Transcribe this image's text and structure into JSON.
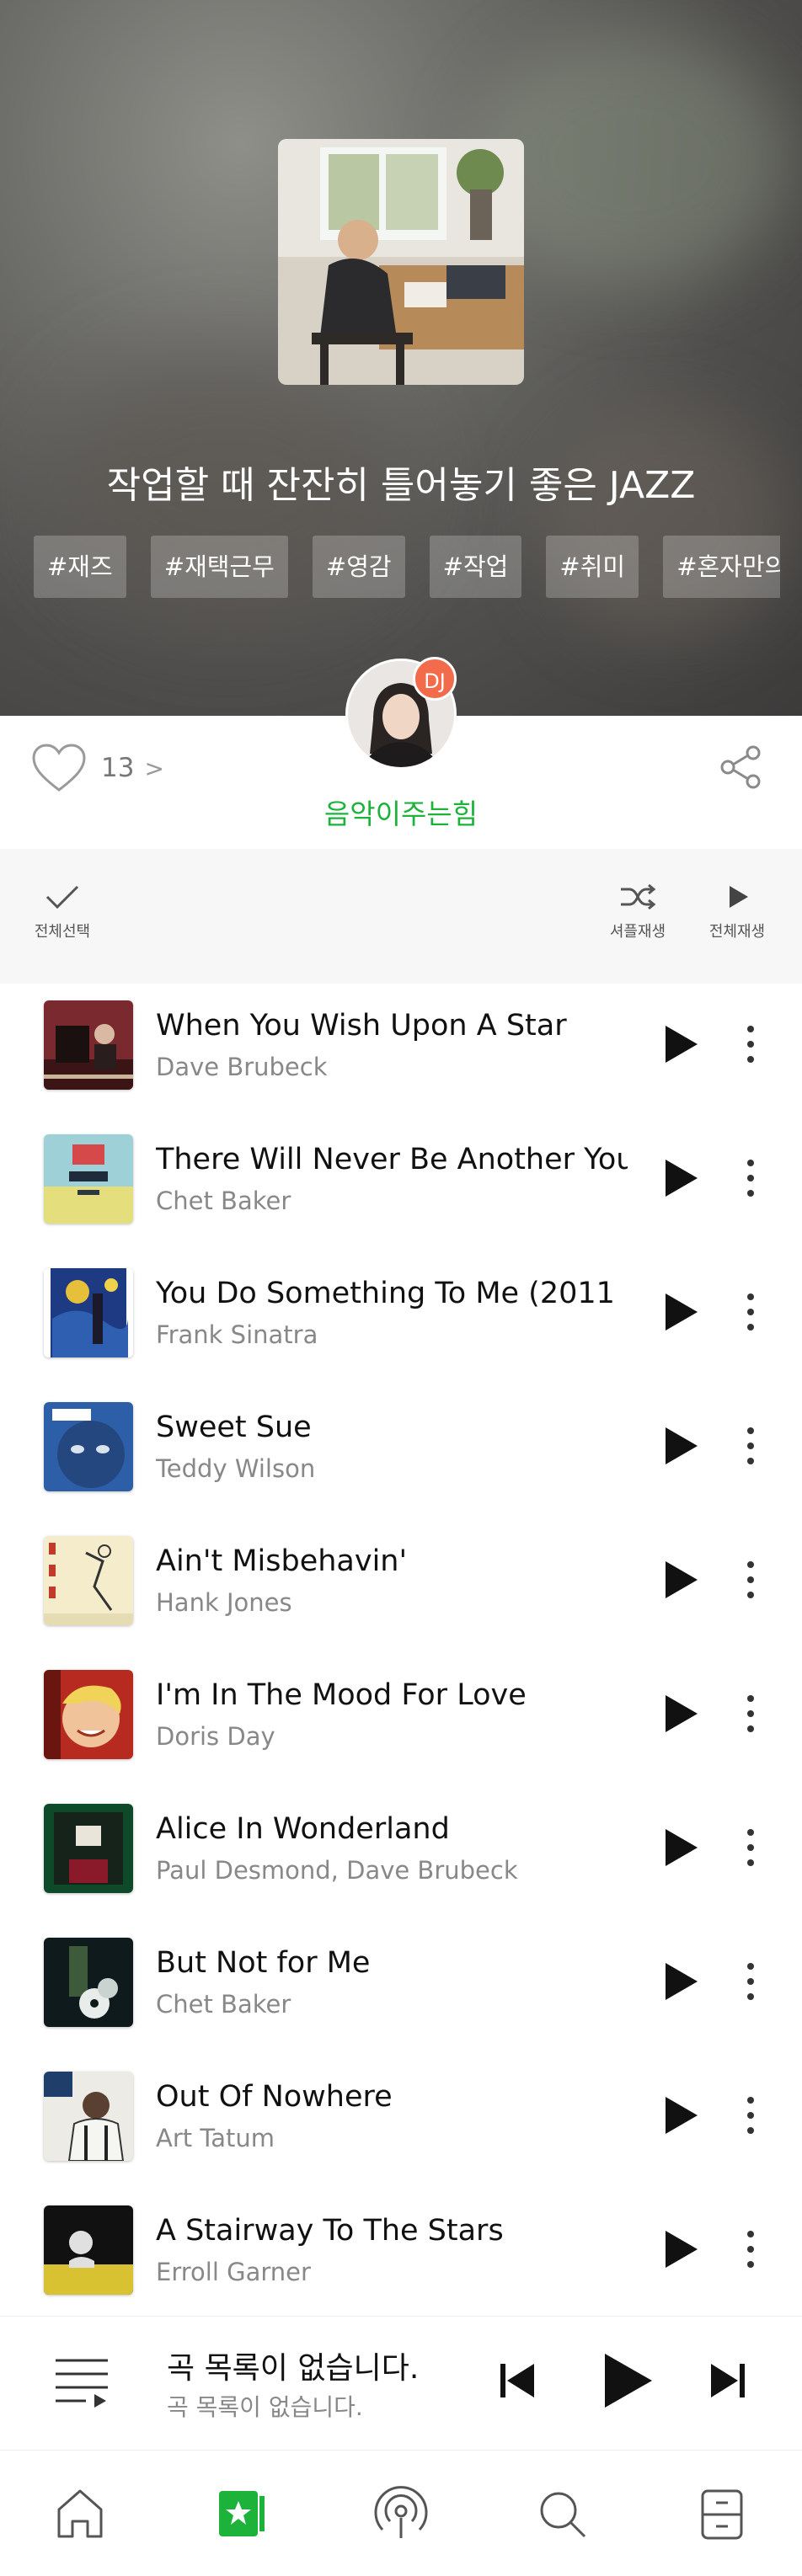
{
  "playlist": {
    "title": "작업할 때 잔잔히 틀어놓기 좋은 JAZZ",
    "tags": [
      "#재즈",
      "#재택근무",
      "#영감",
      "#작업",
      "#취미",
      "#혼자만의시"
    ]
  },
  "dj": {
    "badge": "DJ",
    "name": "음악이주는힘"
  },
  "likes": {
    "count": "13",
    "arrow": ">"
  },
  "toolbar": {
    "select_all_label": "전체선택",
    "shuffle_label": "셔플재생",
    "play_all_label": "전체재생"
  },
  "tracks": [
    {
      "title": "When You Wish Upon A Star",
      "artist": "Dave Brubeck"
    },
    {
      "title": "There Will Never Be Another You",
      "artist": "Chet Baker"
    },
    {
      "title": "You Do Something To Me (2011",
      "artist": "Frank Sinatra"
    },
    {
      "title": "Sweet Sue",
      "artist": "Teddy Wilson"
    },
    {
      "title": "Ain't Misbehavin'",
      "artist": "Hank Jones"
    },
    {
      "title": "I'm In The Mood For Love",
      "artist": "Doris Day"
    },
    {
      "title": "Alice In Wonderland",
      "artist": "Paul Desmond, Dave Brubeck"
    },
    {
      "title": "But Not for Me",
      "artist": "Chet Baker"
    },
    {
      "title": "Out Of Nowhere",
      "artist": "Art Tatum"
    },
    {
      "title": "A Stairway To The Stars",
      "artist": "Erroll Garner"
    }
  ],
  "mini_player": {
    "title": "곡 목록이 없습니다.",
    "subtitle": "곡 목록이 없습니다."
  },
  "nav": {
    "items": [
      "home-icon",
      "my-music-icon",
      "podcast-icon",
      "search-icon",
      "library-icon"
    ]
  },
  "colors": {
    "accent": "#1db33b",
    "dj_badge": "#f26b4b",
    "text_primary": "#111111",
    "text_secondary": "#888888"
  }
}
